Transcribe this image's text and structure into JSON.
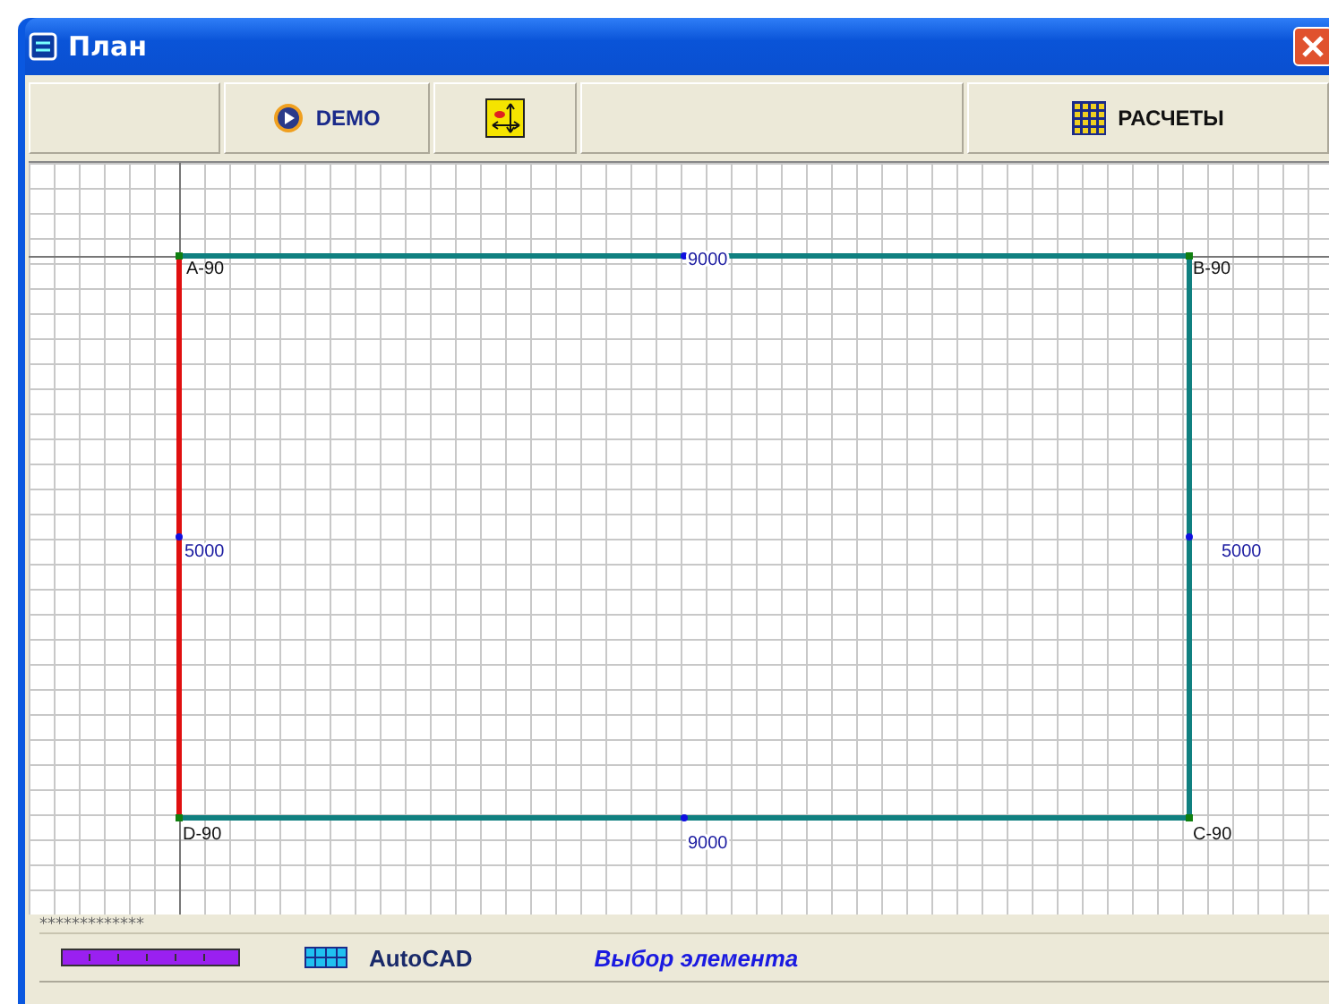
{
  "window": {
    "title": "План"
  },
  "toolbar": [
    {
      "kind": "empty"
    },
    {
      "kind": "demo",
      "label": "DEMO"
    },
    {
      "kind": "move"
    },
    {
      "kind": "gap"
    },
    {
      "kind": "calc",
      "label": "РАСЧЕТЫ"
    }
  ],
  "plan": {
    "corners": [
      {
        "label": "A-90"
      },
      {
        "label": "B-90"
      },
      {
        "label": "D-90"
      },
      {
        "label": "C-90"
      }
    ],
    "walls": [
      {
        "length": "9000",
        "selected": false
      },
      {
        "length": "5000",
        "selected": false
      },
      {
        "length": "9000",
        "selected": false
      },
      {
        "length": "5000",
        "selected": true
      }
    ]
  },
  "status": {
    "caption": "*************",
    "app": "AutoCAD",
    "mode": "Выбор элемента"
  }
}
